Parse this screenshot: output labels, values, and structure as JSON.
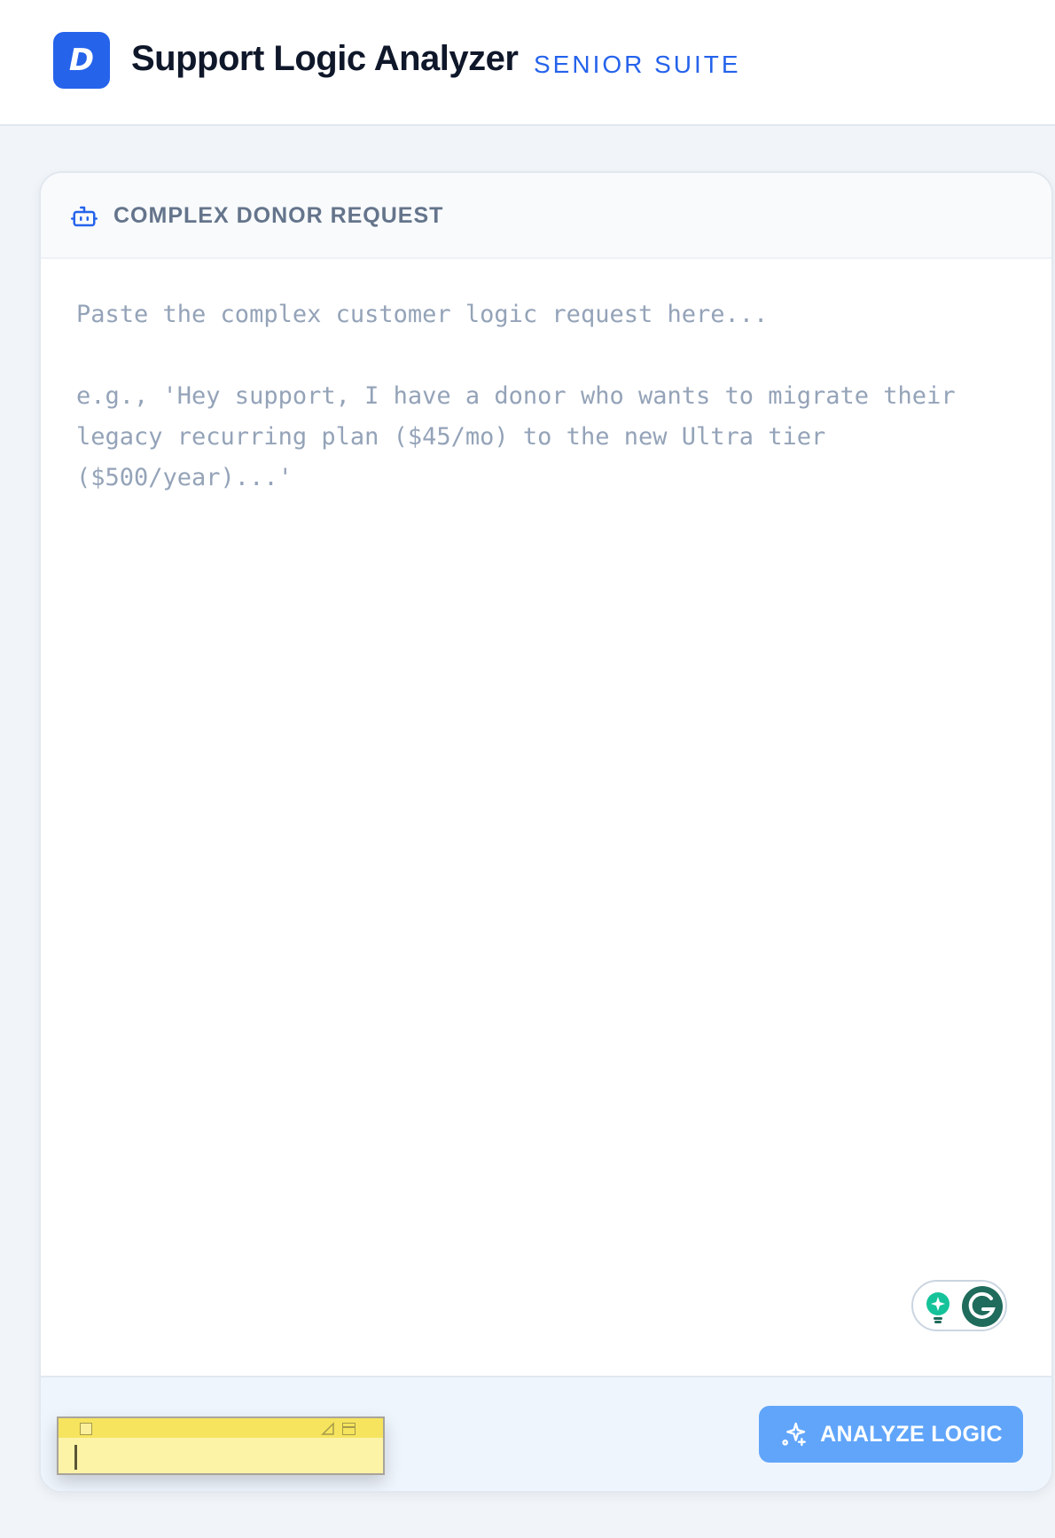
{
  "header": {
    "logo_letter": "D",
    "title": "Support Logic Analyzer",
    "subtitle": "SENIOR SUITE"
  },
  "request_card": {
    "icon": "bot-icon",
    "title": "COMPLEX DONOR REQUEST",
    "textarea": {
      "value": "",
      "placeholder": "Paste the complex customer logic request here...\n\ne.g., 'Hey support, I have a donor who wants to migrate their legacy recurring plan ($45/mo) to the new Ultra tier ($500/year)...'"
    },
    "grammarly_widget": {
      "icons": [
        "lightbulb-icon",
        "grammarly-g-icon"
      ]
    }
  },
  "footer": {
    "sticky_note": {
      "text": ""
    },
    "analyze_button": {
      "icon": "sparkles-icon",
      "label": "ANALYZE LOGIC"
    }
  },
  "colors": {
    "accent": "#2563eb",
    "button": "#60a5fa",
    "page_background": "#f1f5f9",
    "note_yellow": "#fdf3a7",
    "grammarly_green": "#15c39a"
  }
}
